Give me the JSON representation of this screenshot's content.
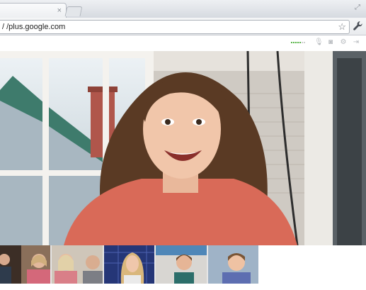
{
  "browser": {
    "tab_close_glyph": "×",
    "url": "/ /plus.google.com",
    "star_icon": "star-icon",
    "wrench_icon": "wrench-icon"
  },
  "hangout": {
    "signal_level": 0.6,
    "controls": [
      "mic-mute-icon",
      "camera-mute-icon",
      "settings-icon",
      "exit-icon"
    ],
    "main_participant": "woman with brown hair smiling, red shirt, porch with swing",
    "participants": [
      "man and woman in room",
      "blonde woman by window",
      "woman with blonde hair and headphones",
      "man in grey room",
      "young man blue wall"
    ]
  }
}
